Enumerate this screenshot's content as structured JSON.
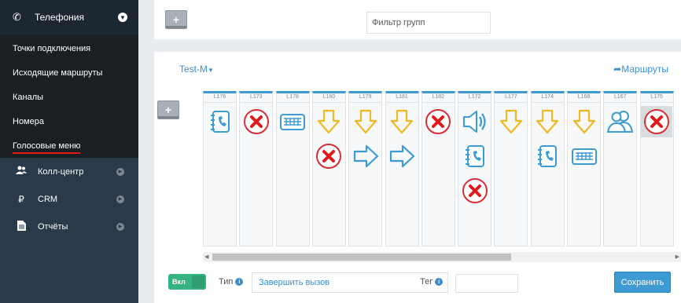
{
  "sidebar": {
    "telephony": {
      "label": "Телефония",
      "icon": "phone-icon"
    },
    "sub_items": [
      {
        "label": "Точки подключения",
        "active": false
      },
      {
        "label": "Исходящие маршруты",
        "active": false
      },
      {
        "label": "Каналы",
        "active": false
      },
      {
        "label": "Номера",
        "active": false
      },
      {
        "label": "Голосовые меню",
        "active": true
      }
    ],
    "main_items": [
      {
        "label": "Колл-центр",
        "icon": "users-icon"
      },
      {
        "label": "CRM",
        "icon": "ruble-icon"
      },
      {
        "label": "Отчёты",
        "icon": "document-icon"
      }
    ]
  },
  "toolbar": {
    "add_label": "+",
    "filter_placeholder": "Фильтр групп"
  },
  "scheme": {
    "name": "Test-M",
    "routes_label": "Маршруты",
    "add_label": "+"
  },
  "columns": [
    {
      "label": "L176",
      "icons": [
        "notebook"
      ]
    },
    {
      "label": "L173",
      "icons": [
        "cross"
      ]
    },
    {
      "label": "L178",
      "icons": [
        "keyboard"
      ]
    },
    {
      "label": "L180",
      "icons": [
        "arrow-down",
        "cross"
      ]
    },
    {
      "label": "L179",
      "icons": [
        "arrow-down",
        "arrow-right"
      ]
    },
    {
      "label": "L181",
      "icons": [
        "arrow-down",
        "arrow-right"
      ]
    },
    {
      "label": "L182",
      "icons": [
        "cross"
      ]
    },
    {
      "label": "L172",
      "icons": [
        "speaker",
        "notebook",
        "cross"
      ]
    },
    {
      "label": "L177",
      "icons": [
        "arrow-down"
      ]
    },
    {
      "label": "L174",
      "icons": [
        "arrow-down",
        "notebook"
      ]
    },
    {
      "label": "L168",
      "icons": [
        "arrow-down",
        "keyboard"
      ]
    },
    {
      "label": "L167",
      "icons": [
        "users"
      ]
    },
    {
      "label": "L175",
      "icons": [
        "cross"
      ]
    }
  ],
  "footer": {
    "toggle_label": "Вкл",
    "type_label": "Тип",
    "type_value": "Завершить вызов",
    "tag_label": "Тег",
    "tag_value": "",
    "save_label": "Сохранить"
  },
  "colors": {
    "accent": "#3d9ad3",
    "red": "#e0191a",
    "yellow": "#f2b824",
    "toggle_green": "#35b37e",
    "sidebar": "#2b3a4a"
  }
}
